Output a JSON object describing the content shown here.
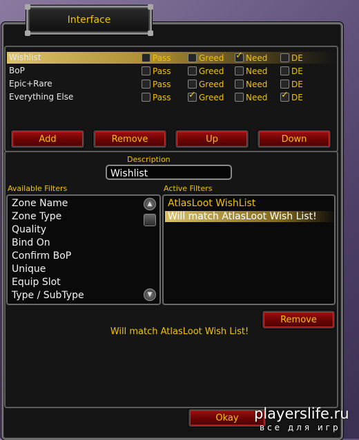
{
  "window": {
    "title": "Interface"
  },
  "rules": [
    {
      "name": "Wishlist",
      "pass": false,
      "greed": false,
      "need": true,
      "de": false,
      "selected": true
    },
    {
      "name": "BoP",
      "pass": false,
      "greed": false,
      "need": false,
      "de": false,
      "selected": false
    },
    {
      "name": "Epic+Rare",
      "pass": false,
      "greed": false,
      "need": false,
      "de": false,
      "selected": false
    },
    {
      "name": "Everything Else",
      "pass": false,
      "greed": true,
      "need": false,
      "de": true,
      "selected": false
    }
  ],
  "option_labels": {
    "pass": "Pass",
    "greed": "Greed",
    "need": "Need",
    "de": "DE"
  },
  "buttons": {
    "add": "Add",
    "remove": "Remove",
    "up": "Up",
    "down": "Down",
    "remove_filter": "Remove",
    "okay": "Okay"
  },
  "description": {
    "label": "Description",
    "value": "Wishlist"
  },
  "available_filters": {
    "label": "Available Filters",
    "items": [
      "Zone Name",
      "Zone Type",
      "Quality",
      "Bind On",
      "Confirm BoP",
      "Unique",
      "Equip Slot",
      "Type / SubType"
    ]
  },
  "active_filters": {
    "label": "Active Filters",
    "items": [
      "AtlasLoot WishList",
      "Will match AtlasLoot Wish List!"
    ]
  },
  "match_message": "Will match AtlasLoot Wish List!",
  "watermark": {
    "site": "playerslife.ru",
    "tagline": "все для игр"
  },
  "colors": {
    "gold": "#f2c200",
    "button_red": "#7a0606",
    "panel_bg": "#151515",
    "border_grey": "#6e6e6e"
  }
}
